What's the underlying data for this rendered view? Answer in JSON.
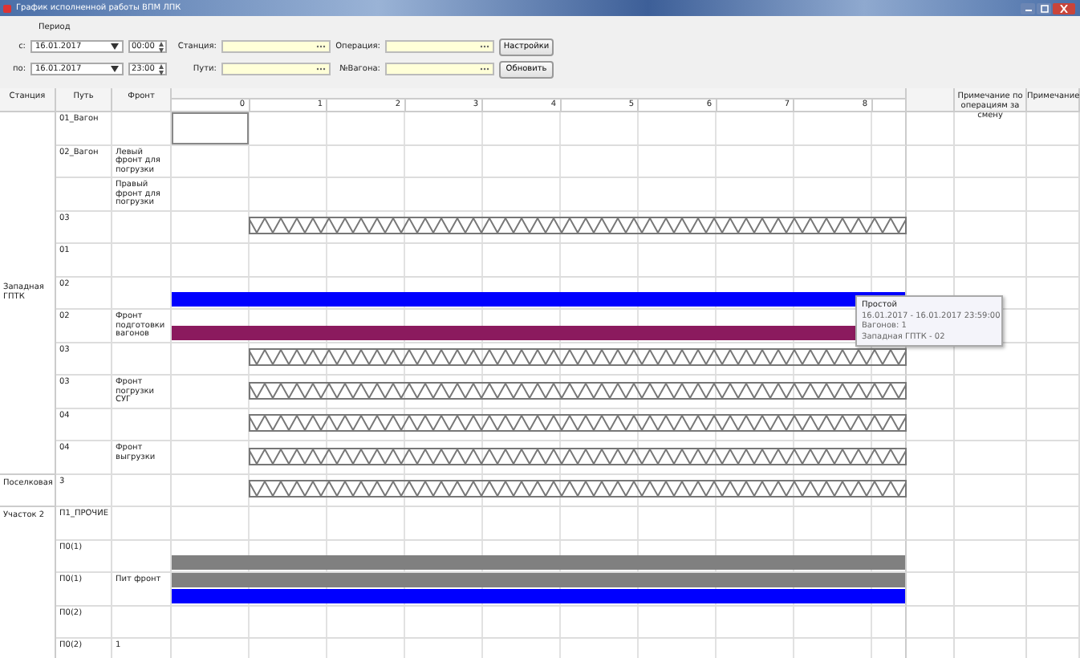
{
  "window": {
    "title": "График исполненной работы ВПМ ЛПК"
  },
  "filters": {
    "period_label": "Период",
    "from": {
      "label": "с:",
      "date": "16.01.2017",
      "time": "00:00"
    },
    "to": {
      "label": "по:",
      "date": "16.01.2017",
      "time": "23:00"
    },
    "fields": [
      {
        "label": "Станция:"
      },
      {
        "label": "Операция:"
      },
      {
        "label": "Пути:"
      },
      {
        "label": "№Вагона:"
      }
    ],
    "buttons": [
      "Настройки",
      "Обновить"
    ]
  },
  "table": {
    "columns": [
      "Станция",
      "Путь",
      "Фронт"
    ],
    "hours": [
      "0",
      "1",
      "2",
      "3",
      "4",
      "5",
      "6",
      "7",
      "8"
    ],
    "note_columns": [
      "Примечание по операциям за смену",
      "Примечание"
    ],
    "stations": [
      {
        "name": "Западная ГПТК",
        "rows": [
          {
            "path": "01_Вагон",
            "selected": true,
            "bars": []
          },
          {
            "path": "02_Вагон",
            "front": "Левый фронт для погрузки",
            "selected": false,
            "bars": []
          },
          {
            "front": "Правый фронт для погрузки",
            "selected": false,
            "bars": []
          },
          {
            "path": "03",
            "selected": false,
            "bars": [
              {
                "kind": "hatched"
              }
            ]
          },
          {
            "path": "01",
            "selected": false,
            "bars": []
          },
          {
            "path": "02",
            "selected": false,
            "bars": [
              {
                "kind": "solid",
                "color": "#0000ff"
              }
            ]
          },
          {
            "path": "02",
            "front": "Фронт подготовки вагонов",
            "selected": false,
            "bars": [
              {
                "kind": "solid",
                "color": "#8b1a5e"
              }
            ]
          },
          {
            "path": "03",
            "selected": false,
            "bars": [
              {
                "kind": "hatched"
              }
            ]
          },
          {
            "path": "03",
            "front": "Фронт погрузки СУГ",
            "selected": false,
            "bars": [
              {
                "kind": "hatched"
              }
            ]
          },
          {
            "path": "04",
            "selected": false,
            "bars": [
              {
                "kind": "hatched"
              }
            ]
          },
          {
            "path": "04",
            "front": "Фронт выгрузки",
            "selected": false,
            "bars": [
              {
                "kind": "hatched"
              }
            ]
          }
        ]
      },
      {
        "name": "Поселковая",
        "rows": [
          {
            "path": "3",
            "selected": false,
            "bars": [
              {
                "kind": "hatched"
              }
            ]
          }
        ]
      },
      {
        "name": "Участок 2",
        "rows": [
          {
            "path": "П1_ПРОЧИЕ",
            "selected": false,
            "bars": []
          },
          {
            "path": "П0(1)",
            "selected": false,
            "bars": [
              {
                "kind": "solid",
                "color": "#808080"
              }
            ]
          },
          {
            "path": "П0(1)",
            "front": "Пит фронт",
            "selected": false,
            "bars": [
              {
                "kind": "solid",
                "color": "#808080"
              },
              {
                "kind": "solid",
                "color": "#0000ff"
              }
            ]
          },
          {
            "path": "П0(2)",
            "selected": false,
            "bars": []
          },
          {
            "path": "П0(2)",
            "front": "1",
            "selected": false,
            "bars": []
          }
        ]
      }
    ]
  },
  "tooltip": {
    "title": "Простой",
    "lines": [
      "16.01.2017 - 16.01.2017 23:59:00",
      "Вагонов: 1",
      "Западная ГПТК - 02"
    ]
  }
}
